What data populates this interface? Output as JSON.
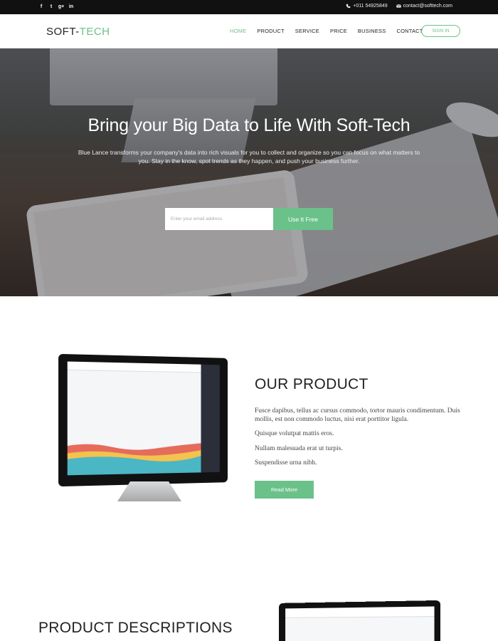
{
  "topbar": {
    "social_icons": [
      "facebook-icon",
      "twitter-icon",
      "google-plus-icon",
      "linkedin-icon"
    ],
    "social_glyphs": [
      "f",
      "t",
      "g+",
      "in"
    ],
    "phone": "+011 54925849",
    "email": "contact@softtech.com"
  },
  "brand": {
    "logo_main": "SOFT-",
    "logo_accent": "TECH",
    "accent_color": "#6bc18a"
  },
  "nav": {
    "items": [
      {
        "label": "HOME",
        "active": true
      },
      {
        "label": "PRODUCT",
        "active": false
      },
      {
        "label": "SERVICE",
        "active": false
      },
      {
        "label": "PRICE",
        "active": false
      },
      {
        "label": "BUSINESS",
        "active": false
      },
      {
        "label": "CONTACT",
        "active": false
      }
    ],
    "signin_label": "SIGN IN"
  },
  "hero": {
    "title": "Bring your Big Data to Life With Soft-Tech",
    "subtitle": "Blue Lance transforms your company's data into rich visuals for you to collect and organize so you can focus on what matters to you. Stay in the know, spot trends as they happen, and push your business further.",
    "email_placeholder": "Enter your email address",
    "cta_label": "Use It Free"
  },
  "product": {
    "title": "OUR PRODUCT",
    "paragraphs": [
      "Fusce dapibus, tellus ac cursus commodo, tortor mauris condimentum. Duis mollis, est non commodo luctus, nisi erat porttitor ligula.",
      "Quisque volutpat mattis eros.",
      "Nullam malesuada erat ut turpis.",
      "Suspendisse urna nibh."
    ],
    "button_label": "Read More"
  },
  "descriptions": {
    "title": "PRODUCT DESCRIPTIONS"
  }
}
